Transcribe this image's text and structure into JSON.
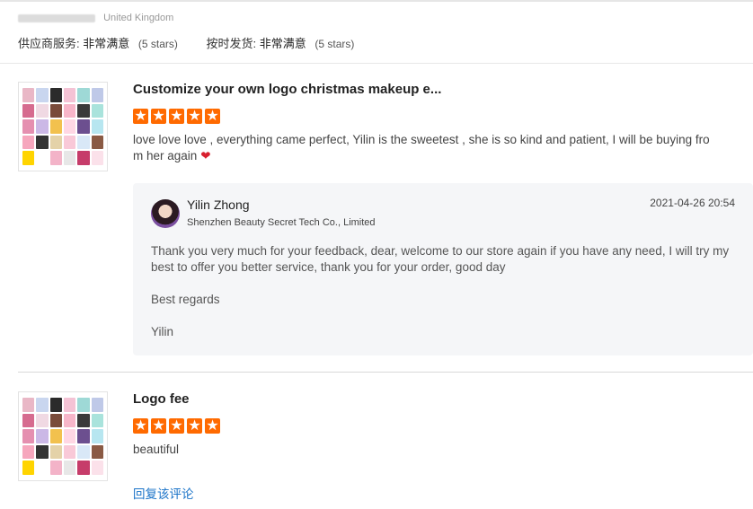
{
  "reviewer": {
    "country": "United Kingdom"
  },
  "seller_ratings": [
    {
      "label": "供应商服务:",
      "value": "非常满意",
      "note": "(5 stars)"
    },
    {
      "label": "按时发货:",
      "value": "非常满意",
      "note": "(5 stars)"
    }
  ],
  "reviews": [
    {
      "product_title": "Customize your own logo christmas makeup e...",
      "rating": 5,
      "comment_line1": "love love love , everything came perfect, Yilin is the sweetest , she is so kind and patient, I will be buying fro",
      "comment_line2": "m her again",
      "reply": {
        "author": "Yilin Zhong",
        "company": "Shenzhen Beauty Secret Tech Co., Limited",
        "date": "2021-04-26 20:54",
        "line1": "Thank you very much for your feedback, dear, welcome to our store again if you have any need, I will try my",
        "line2": "best to offer you better service, thank you for your order, good day",
        "regards": "Best regards",
        "signature": "Yilin"
      }
    },
    {
      "product_title": "Logo fee",
      "rating": 5,
      "comment_line1": "beautiful",
      "reply_link": "回复该评论"
    }
  ],
  "colors": {
    "star": "#ff6a00",
    "link": "#1a73c8",
    "reply_bg": "#f5f6f8"
  },
  "icons": [
    "star-icon",
    "heart-icon",
    "avatar"
  ]
}
